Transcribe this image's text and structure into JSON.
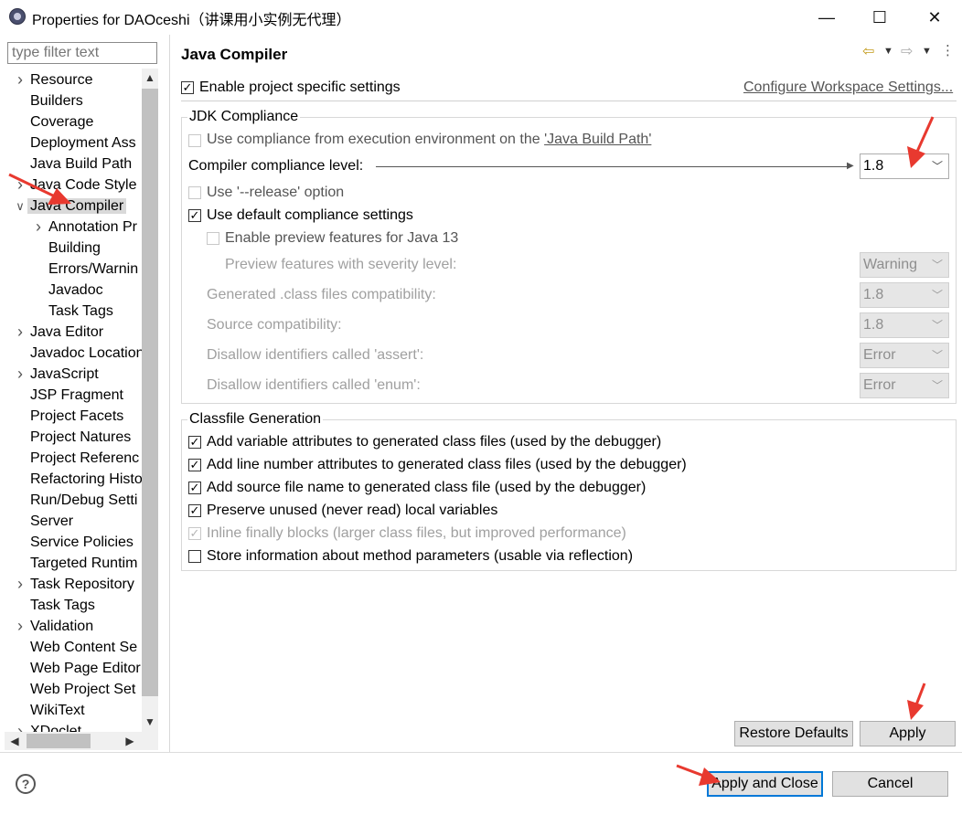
{
  "window": {
    "title": "Properties for DAOceshi（讲课用小实例无代理）",
    "minimize": "—",
    "maximize": "☐",
    "close": "✕"
  },
  "filter": {
    "placeholder": "type filter text"
  },
  "tree": [
    {
      "label": "Resource",
      "expandable": true,
      "level": 0
    },
    {
      "label": "Builders",
      "expandable": false,
      "level": 0
    },
    {
      "label": "Coverage",
      "expandable": false,
      "level": 0
    },
    {
      "label": "Deployment Ass",
      "expandable": false,
      "level": 0
    },
    {
      "label": "Java Build Path",
      "expandable": false,
      "level": 0
    },
    {
      "label": "Java Code Style",
      "expandable": true,
      "level": 0
    },
    {
      "label": "Java Compiler",
      "expandable": true,
      "expanded": true,
      "selected": true,
      "level": 0
    },
    {
      "label": "Annotation Pr",
      "expandable": true,
      "level": 1
    },
    {
      "label": "Building",
      "expandable": false,
      "level": 1
    },
    {
      "label": "Errors/Warnin",
      "expandable": false,
      "level": 1
    },
    {
      "label": "Javadoc",
      "expandable": false,
      "level": 1
    },
    {
      "label": "Task Tags",
      "expandable": false,
      "level": 1
    },
    {
      "label": "Java Editor",
      "expandable": true,
      "level": 0
    },
    {
      "label": "Javadoc Location",
      "expandable": false,
      "level": 0
    },
    {
      "label": "JavaScript",
      "expandable": true,
      "level": 0
    },
    {
      "label": "JSP Fragment",
      "expandable": false,
      "level": 0
    },
    {
      "label": "Project Facets",
      "expandable": false,
      "level": 0
    },
    {
      "label": "Project Natures",
      "expandable": false,
      "level": 0
    },
    {
      "label": "Project Referenc",
      "expandable": false,
      "level": 0
    },
    {
      "label": "Refactoring Histo",
      "expandable": false,
      "level": 0
    },
    {
      "label": "Run/Debug Setti",
      "expandable": false,
      "level": 0
    },
    {
      "label": "Server",
      "expandable": false,
      "level": 0
    },
    {
      "label": "Service Policies",
      "expandable": false,
      "level": 0
    },
    {
      "label": "Targeted Runtim",
      "expandable": false,
      "level": 0
    },
    {
      "label": "Task Repository",
      "expandable": true,
      "level": 0
    },
    {
      "label": "Task Tags",
      "expandable": false,
      "level": 0
    },
    {
      "label": "Validation",
      "expandable": true,
      "level": 0
    },
    {
      "label": "Web Content Se",
      "expandable": false,
      "level": 0
    },
    {
      "label": "Web Page Editor",
      "expandable": false,
      "level": 0
    },
    {
      "label": "Web Project Set",
      "expandable": false,
      "level": 0
    },
    {
      "label": "WikiText",
      "expandable": false,
      "level": 0
    },
    {
      "label": "XDoclet",
      "expandable": true,
      "level": 0
    }
  ],
  "panel": {
    "title": "Java Compiler",
    "enable_project_specific": {
      "label": "Enable project specific settings",
      "checked": true
    },
    "configure_link": "Configure Workspace Settings...",
    "jdk": {
      "group_title": "JDK Compliance",
      "use_env_prefix": "Use compliance from execution environment on the ",
      "use_env_link": "'Java Build Path'",
      "compliance_level_label": "Compiler compliance level:",
      "compliance_level_value": "1.8",
      "release_option": "Use '--release' option",
      "use_default": "Use default compliance settings",
      "enable_preview": "Enable preview features for Java 13",
      "preview_severity_label": "Preview features with severity level:",
      "preview_severity_value": "Warning",
      "generated_label": "Generated .class files compatibility:",
      "generated_value": "1.8",
      "source_label": "Source compatibility:",
      "source_value": "1.8",
      "assert_label": "Disallow identifiers called 'assert':",
      "assert_value": "Error",
      "enum_label": "Disallow identifiers called 'enum':",
      "enum_value": "Error"
    },
    "classfile": {
      "group_title": "Classfile Generation",
      "items": [
        {
          "label": "Add variable attributes to generated class files (used by the debugger)",
          "checked": true,
          "enabled": true
        },
        {
          "label": "Add line number attributes to generated class files (used by the debugger)",
          "checked": true,
          "enabled": true
        },
        {
          "label": "Add source file name to generated class file (used by the debugger)",
          "checked": true,
          "enabled": true
        },
        {
          "label": "Preserve unused (never read) local variables",
          "checked": true,
          "enabled": true
        },
        {
          "label": "Inline finally blocks (larger class files, but improved performance)",
          "checked": true,
          "enabled": false
        },
        {
          "label": "Store information about method parameters (usable via reflection)",
          "checked": false,
          "enabled": true
        }
      ]
    },
    "restore_defaults": "Restore Defaults",
    "apply": "Apply"
  },
  "footer": {
    "help": "?",
    "apply_and_close": "Apply and Close",
    "cancel": "Cancel"
  },
  "colors": {
    "annotation_arrow": "#e8392f",
    "focus_border": "#0078d7"
  }
}
